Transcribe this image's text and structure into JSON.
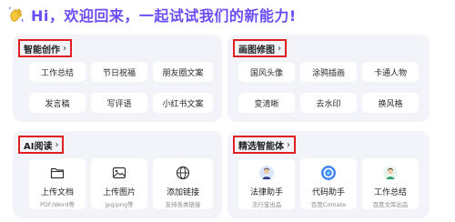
{
  "greeting": {
    "emoji_icon": "waving-hand-icon",
    "text": "Hi，欢迎回来，一起试试我们的新能力!"
  },
  "colors": {
    "accent": "#6b4cf6",
    "highlight_border": "#e02020",
    "panel_bg": "#f3f4fa"
  },
  "panels": {
    "smart_create": {
      "title": "智能创作",
      "items": [
        "工作总结",
        "节日祝福",
        "朋友圈文案",
        "发言稿",
        "写评语",
        "小红书文案"
      ]
    },
    "image_edit": {
      "title": "画图修图",
      "items": [
        "国风头像",
        "涂鸦插画",
        "卡通人物",
        "变清晰",
        "去水印",
        "换风格"
      ]
    },
    "ai_read": {
      "title": "AI阅读",
      "cards": [
        {
          "name": "上传文档",
          "sub": "PDF/Word等",
          "icon": "folder-icon"
        },
        {
          "name": "上传图片",
          "sub": "jpg/png等",
          "icon": "image-icon"
        },
        {
          "name": "添加链接",
          "sub": "支持各类链接",
          "icon": "globe-icon"
        }
      ]
    },
    "agents": {
      "title": "精选智能体",
      "cards": [
        {
          "name": "法律助手",
          "sub": "法行宝出品",
          "icon": "lawyer-avatar-icon"
        },
        {
          "name": "代码助手",
          "sub": "百度Comate",
          "icon": "comate-logo-icon"
        },
        {
          "name": "工作总结",
          "sub": "百度文库出品",
          "icon": "worker-avatar-icon"
        }
      ]
    }
  }
}
